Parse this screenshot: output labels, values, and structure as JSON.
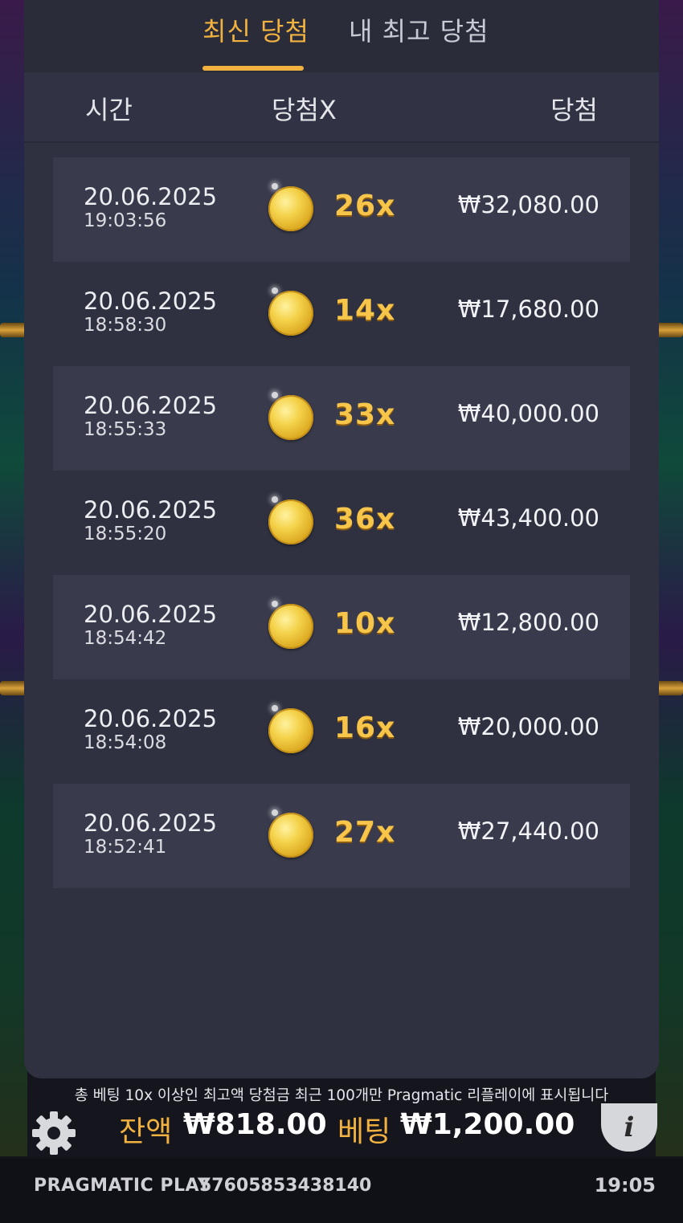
{
  "tabs": {
    "latest": "최신 당첨",
    "my_best": "내 최고 당첨"
  },
  "columns": {
    "time": "시간",
    "multiplier": "당첨X",
    "win": "당첨"
  },
  "rows": [
    {
      "date": "20.06.2025",
      "time": "19:03:56",
      "multiplier": "26x",
      "amount": "₩32,080.00"
    },
    {
      "date": "20.06.2025",
      "time": "18:58:30",
      "multiplier": "14x",
      "amount": "₩17,680.00"
    },
    {
      "date": "20.06.2025",
      "time": "18:55:33",
      "multiplier": "33x",
      "amount": "₩40,000.00"
    },
    {
      "date": "20.06.2025",
      "time": "18:55:20",
      "multiplier": "36x",
      "amount": "₩43,400.00"
    },
    {
      "date": "20.06.2025",
      "time": "18:54:42",
      "multiplier": "10x",
      "amount": "₩12,800.00"
    },
    {
      "date": "20.06.2025",
      "time": "18:54:08",
      "multiplier": "16x",
      "amount": "₩20,000.00"
    },
    {
      "date": "20.06.2025",
      "time": "18:52:41",
      "multiplier": "27x",
      "amount": "₩27,440.00"
    }
  ],
  "notice": "총 베팅 10x 이상인 최고액 당첨금 최근 100개만 Pragmatic 리플레이에 표시됩니다",
  "bottom": {
    "balance_label": "잔액",
    "balance_value": "₩818.00",
    "bet_label": "베팅",
    "bet_value": "₩1,200.00",
    "info_glyph": "i"
  },
  "footer": {
    "brand": "PRAGMATIC PLAY",
    "round_id": "57605853438140",
    "clock": "19:05"
  },
  "icons": [
    "gear-icon",
    "coin-icon",
    "info-icon"
  ],
  "colors": {
    "accent": "#f1b23f",
    "panel": "#2f3140"
  }
}
